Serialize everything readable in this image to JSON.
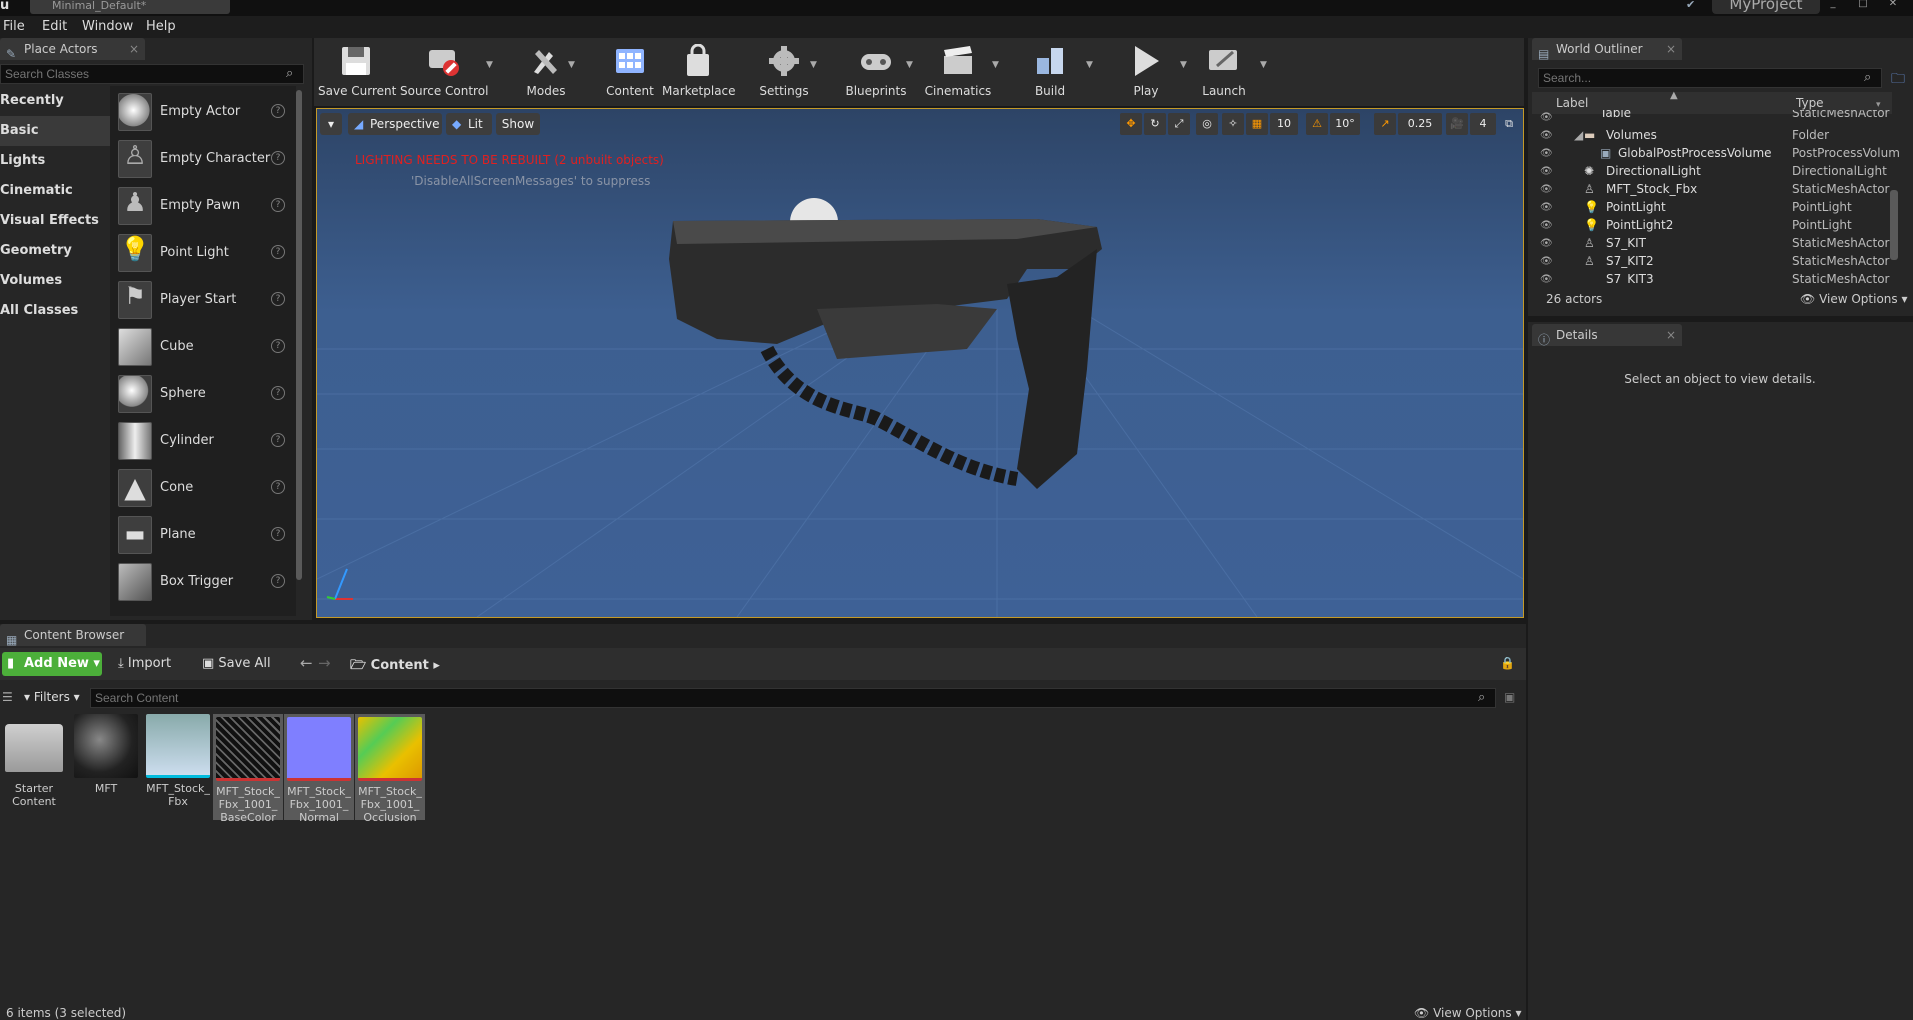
{
  "titlebar": {
    "doc_tab": "Minimal_Default*",
    "logo": "u",
    "project": "MyProject"
  },
  "menu": [
    "File",
    "Edit",
    "Window",
    "Help"
  ],
  "place_actors": {
    "tab": "Place Actors",
    "search_placeholder": "Search Classes",
    "categories": [
      "Recently Placed",
      "Basic",
      "Lights",
      "Cinematic",
      "Visual Effects",
      "Geometry",
      "Volumes",
      "All Classes"
    ],
    "selected_category": "Basic",
    "actors": [
      "Empty Actor",
      "Empty Character",
      "Empty Pawn",
      "Point Light",
      "Player Start",
      "Cube",
      "Sphere",
      "Cylinder",
      "Cone",
      "Plane",
      "Box Trigger"
    ]
  },
  "toolbar": [
    "Save Current",
    "Source Control",
    "Modes",
    "Content",
    "Marketplace",
    "Settings",
    "Blueprints",
    "Cinematics",
    "Build",
    "Play",
    "Launch"
  ],
  "viewport": {
    "perspective": "Perspective",
    "lit": "Lit",
    "show": "Show",
    "grid_snap": "10",
    "rotation_snap": "10°",
    "scale_snap": "0.25",
    "camera_speed": "4",
    "warning": "LIGHTING NEEDS TO BE REBUILT (2 unbuilt objects)",
    "suppress_hint": "'DisableAllScreenMessages' to suppress"
  },
  "world_outliner": {
    "tab": "World Outliner",
    "search_placeholder": "Search...",
    "col_label": "Label",
    "col_type": "Type",
    "rows": [
      {
        "label": "Table",
        "type": "StaticMeshActor"
      },
      {
        "label": "Volumes",
        "type": "Folder"
      },
      {
        "label": "GlobalPostProcessVolume",
        "type": "PostProcessVolum"
      },
      {
        "label": "DirectionalLight",
        "type": "DirectionalLight"
      },
      {
        "label": "MFT_Stock_Fbx",
        "type": "StaticMeshActor"
      },
      {
        "label": "PointLight",
        "type": "PointLight"
      },
      {
        "label": "PointLight2",
        "type": "PointLight"
      },
      {
        "label": "S7_KIT",
        "type": "StaticMeshActor"
      },
      {
        "label": "S7_KIT2",
        "type": "StaticMeshActor"
      },
      {
        "label": "S7_KIT3",
        "type": "StaticMeshActor"
      }
    ],
    "count": "26 actors",
    "view_options": "View Options"
  },
  "details": {
    "tab": "Details",
    "empty_message": "Select an object to view details."
  },
  "content_browser": {
    "tab": "Content Browser",
    "add_new": "Add New",
    "import": "Import",
    "save_all": "Save All",
    "path": "Content",
    "filters": "Filters",
    "search_placeholder": "Search Content",
    "items": [
      {
        "name": "Starter Content"
      },
      {
        "name": "MFT"
      },
      {
        "name": "MFT_Stock_ Fbx"
      },
      {
        "name": "MFT_Stock_ Fbx_1001_ BaseColor"
      },
      {
        "name": "MFT_Stock_ Fbx_1001_ Normal"
      },
      {
        "name": "MFT_Stock_ Fbx_1001_ Occlusion"
      }
    ],
    "status": "6 items (3 selected)",
    "view_options": "View Options"
  },
  "colors": {
    "accent_green": "#4caf3a",
    "warning_red": "#e02020",
    "viewport_sky": "#3f5f8c"
  }
}
